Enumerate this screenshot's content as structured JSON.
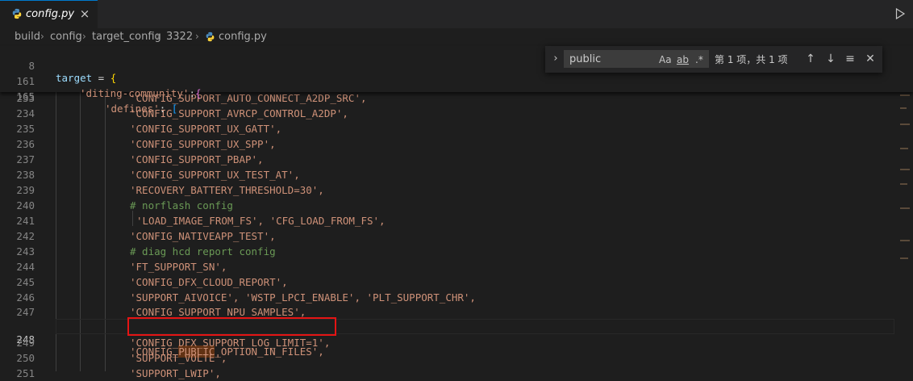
{
  "tab": {
    "label": "config.py",
    "close": "×"
  },
  "breadcrumb": [
    "build",
    "config",
    "target_config",
    "3322",
    "config.py"
  ],
  "find": {
    "value": "public",
    "opt_case": "Aa",
    "opt_word": "ab",
    "opt_regex": ".*",
    "count": "第 1 项，共 1 项"
  },
  "sticky_lines": [
    {
      "num": "8",
      "text": "target = {"
    },
    {
      "num": "161",
      "text": "'diting-community':{"
    },
    {
      "num": "165",
      "text": "'defines': ["
    }
  ],
  "lines": [
    {
      "num": "233",
      "text": "'CONFIG_SUPPORT_AUTO_CONNECT_A2DP_SRC',"
    },
    {
      "num": "234",
      "text": "'CONFIG_SUPPORT_AVRCP_CONTROL_A2DP',"
    },
    {
      "num": "235",
      "text": "'CONFIG_SUPPORT_UX_GATT',"
    },
    {
      "num": "236",
      "text": "'CONFIG_SUPPORT_UX_SPP',"
    },
    {
      "num": "237",
      "text": "'CONFIG_SUPPORT_PBAP',"
    },
    {
      "num": "238",
      "text": "'CONFIG_SUPPORT_UX_TEST_AT',"
    },
    {
      "num": "239",
      "text": "'RECOVERY_BATTERY_THRESHOLD=30',"
    },
    {
      "num": "240",
      "text": "# norflash config"
    },
    {
      "num": "241",
      "text": "'LOAD_IMAGE_FROM_FS', 'CFG_LOAD_FROM_FS',"
    },
    {
      "num": "242",
      "text": "'CONFIG_NATIVEAPP_TEST',"
    },
    {
      "num": "243",
      "text": "# diag hcd report config"
    },
    {
      "num": "244",
      "text": "'FT_SUPPORT_SN',"
    },
    {
      "num": "245",
      "text": "'CONFIG_DFX_CLOUD_REPORT',"
    },
    {
      "num": "246",
      "text": "'SUPPORT_AIVOICE', 'WSTP_LPCI_ENABLE', 'PLT_SUPPORT_CHR',"
    },
    {
      "num": "247",
      "text": "'CONFIG_SUPPORT_NPU_SAMPLES',"
    },
    {
      "num": "248",
      "pre": "'CONFIG_",
      "match": "PUBLIC",
      "post": "_OPTION_IN_FILES',"
    },
    {
      "num": "249",
      "text": "'CONFIG_DFX_SUPPORT_LOG_LIMIT=1',"
    },
    {
      "num": "250",
      "text": "'SUPPORT_VOLTE',"
    },
    {
      "num": "251",
      "text": "'SUPPORT_LWIP',"
    }
  ],
  "colors": {
    "accent": "#007acc",
    "highlight_box": "#e51414",
    "match": "#613214"
  }
}
